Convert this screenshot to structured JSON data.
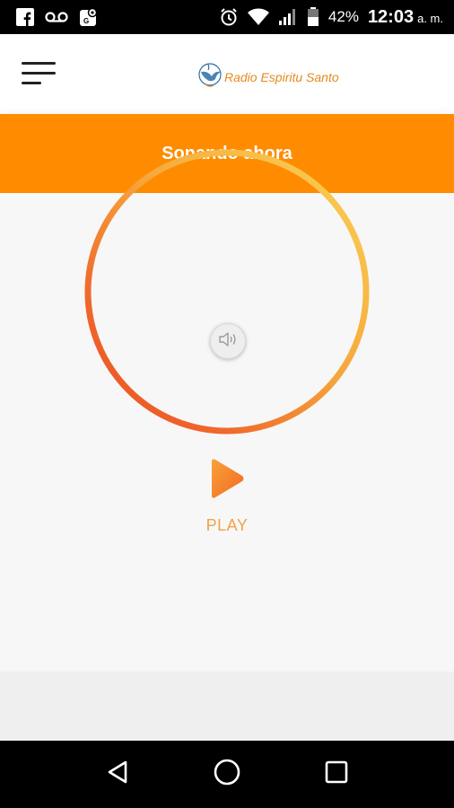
{
  "status_bar": {
    "battery_percent": "42%",
    "time": "12:03",
    "ampm": "a. m.",
    "icons": [
      "facebook-icon",
      "voicemail-icon",
      "maps-icon",
      "alarm-icon",
      "wifi-icon",
      "signal-icon",
      "battery-icon"
    ]
  },
  "header": {
    "logo_text": "Radio Espiritu Santo",
    "menu_icon": "hamburger-menu-icon"
  },
  "title_bar": {
    "title": "Sonando ahora"
  },
  "player": {
    "play_label": "PLAY",
    "volume_icon": "speaker-icon",
    "ring_colors": {
      "top": "#f9cf4b",
      "left": "#ee4422",
      "bottom": "#f0562a",
      "right": "#f7b84a"
    },
    "play_color": "#f58a2c"
  },
  "nav_bar": {
    "buttons": [
      "back-icon",
      "home-icon",
      "recents-icon"
    ]
  },
  "colors": {
    "accent": "#ff8c00",
    "background": "#f7f7f7"
  }
}
